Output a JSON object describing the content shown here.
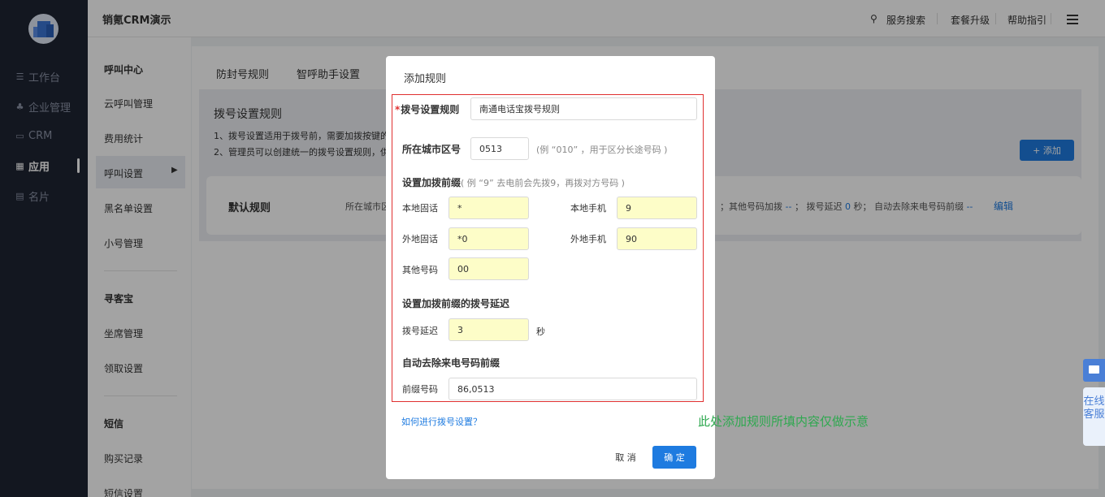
{
  "sidebar": {
    "items": [
      {
        "label": "工作台",
        "icon": "menu-lines-icon"
      },
      {
        "label": "企业管理",
        "icon": "org-chart-icon"
      },
      {
        "label": "CRM",
        "icon": "crm-icon"
      },
      {
        "label": "应用",
        "icon": "apps-grid-icon"
      },
      {
        "label": "名片",
        "icon": "card-icon"
      }
    ],
    "active_index": 3
  },
  "header": {
    "title": "销氪CRM演示",
    "links": [
      "服务搜索",
      "套餐升级",
      "帮助指引"
    ]
  },
  "submenu": {
    "section1": "呼叫中心",
    "section1_items": [
      "云呼叫管理",
      "费用统计",
      "呼叫设置",
      "黑名单设置",
      "小号管理"
    ],
    "section2": "寻客宝",
    "section2_items": [
      "坐席管理",
      "领取设置"
    ],
    "section3": "短信",
    "section3_items": [
      "购买记录",
      "短信设置"
    ],
    "active": "呼叫设置"
  },
  "main": {
    "tabs": [
      "防封号规则",
      "智呼助手设置"
    ],
    "rules_title": "拨号设置规则",
    "desc1": "1、拨号设置适用于拨号前，需要加拨按键的",
    "desc2": "2、管理员可以创建统一的拨号设置规则，供",
    "add_button": "+ 添加",
    "default_rule": {
      "name": "默认规则",
      "left_text": "所在城市区",
      "right_p1": "；其他号码加拨 ",
      "right_v1": "--",
      "right_p2": " ； 拨号延迟 ",
      "right_v2": "0",
      "right_p3": " 秒； 自动去除来电号码前缀 ",
      "right_v3": "--",
      "edit": "编辑"
    }
  },
  "modal": {
    "title": "添加规则",
    "rule_name_label": "拨号设置规则",
    "rule_name_value": "南通电话宝拨号规则",
    "area_code_label": "所在城市区号",
    "area_code_value": "0513",
    "area_code_hint": "(例 “010” ，用于区分长途号码 )",
    "prefix_label": "设置加拨前缀",
    "prefix_hint": "( 例 “9” 去电前会先拨9，再拨对方号码 )",
    "local_fixed_label": "本地固话",
    "local_fixed_value": "*",
    "local_mobile_label": "本地手机",
    "local_mobile_value": "9",
    "remote_fixed_label": "外地固话",
    "remote_fixed_value": "*0",
    "remote_mobile_label": "外地手机",
    "remote_mobile_value": "90",
    "other_label": "其他号码",
    "other_value": "00",
    "delay_section_label": "设置加拨前缀的拨号延迟",
    "delay_label": "拨号延迟",
    "delay_value": "3",
    "delay_unit": "秒",
    "strip_section_label": "自动去除来电号码前缀",
    "strip_label": "前缀号码",
    "strip_value": "86,0513",
    "help_link": "如何进行拨号设置？",
    "cancel": "取 消",
    "ok": "确 定"
  },
  "note": "此处添加规则所填内容仅做示意",
  "float_service": "在线客服",
  "colors": {
    "primary": "#1e7be0",
    "sidebar": "#1f2432",
    "highlight": "#fdfdc8",
    "note": "#2ea84f",
    "red": "#e03030"
  }
}
